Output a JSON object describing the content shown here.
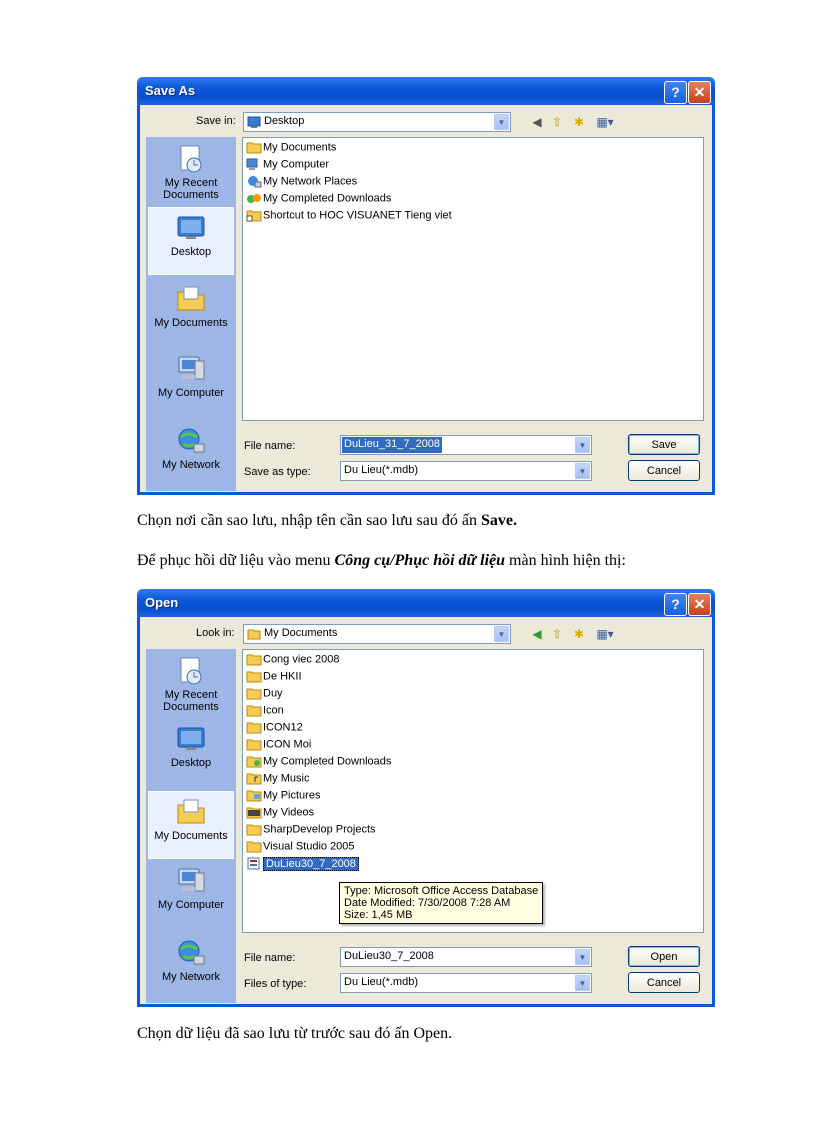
{
  "save_dialog": {
    "title": "Save As",
    "look_label": "Save in:",
    "look_value": "Desktop",
    "places": [
      "My Recent Documents",
      "Desktop",
      "My Documents",
      "My Computer",
      "My Network"
    ],
    "files": [
      "My Documents",
      "My Computer",
      "My Network Places",
      "My Completed Downloads",
      "Shortcut to HOC VISUANET Tieng viet"
    ],
    "filename_label": "File name:",
    "filename_value": "DuLieu_31_7_2008",
    "type_label": "Save as type:",
    "type_value": "Du Lieu(*.mdb)",
    "primary_button": "Save",
    "cancel_button": "Cancel"
  },
  "open_dialog": {
    "title": "Open",
    "look_label": "Look in:",
    "look_value": "My Documents",
    "places": [
      "My Recent Documents",
      "Desktop",
      "My Documents",
      "My Computer",
      "My Network"
    ],
    "files": [
      "Cong viec 2008",
      "De HKII",
      "Duy",
      "Icon",
      "ICON12",
      "ICON Moi",
      "My Completed Downloads",
      "My Music",
      "My Pictures",
      "My Videos",
      "SharpDevelop Projects",
      "Visual Studio 2005",
      "DuLieu30_7_2008"
    ],
    "tooltip": [
      "Type: Microsoft Office Access Database",
      "Date Modified: 7/30/2008 7:28 AM",
      "Size: 1,45 MB"
    ],
    "filename_label": "File name:",
    "filename_value": "DuLieu30_7_2008",
    "type_label": "Files of type:",
    "type_value": "Du Lieu(*.mdb)",
    "primary_button": "Open",
    "cancel_button": "Cancel"
  },
  "captions": {
    "c1_text": "Chọn nơi cần sao lưu, nhập tên cần sao lưu sau đó ấn ",
    "c1_bold": "Save.",
    "c2_text": "Để phục hồi dữ liệu vào menu ",
    "c2_bold": "Công cụ/Phục hồi dữ liệu",
    "c2_tail": " màn hình hiện thị:",
    "c3_text": "Chọn dữ liệu đã sao lưu từ trước sau đó ấn Open."
  },
  "colors": {
    "titlebar": "#0a5ad8",
    "dialog_bg": "#ece9d8",
    "places_bar": "#9eb6e6",
    "selection": "#316ac5"
  }
}
